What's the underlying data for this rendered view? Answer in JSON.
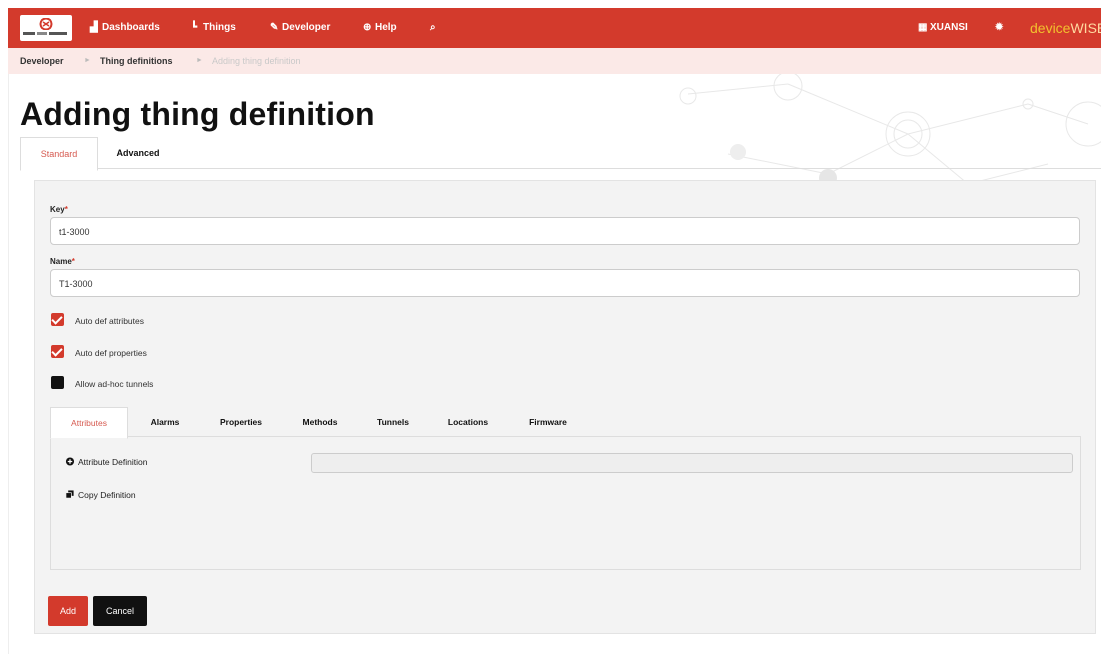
{
  "nav": {
    "items": [
      {
        "label": "Dashboards",
        "icon": "bar-chart-icon"
      },
      {
        "label": "Things",
        "icon": "sitemap-icon"
      },
      {
        "label": "Developer",
        "icon": "wrench-icon"
      },
      {
        "label": "Help",
        "icon": "help-circle-icon"
      }
    ],
    "search_icon": "search-icon",
    "user": "XUANSI",
    "settings_icon": "gear-icon",
    "brand_part1": "device",
    "brand_part2": "WISE"
  },
  "breadcrumb": {
    "items": [
      "Developer",
      "Thing definitions"
    ],
    "current": "Adding thing definition"
  },
  "page": {
    "title": "Adding thing definition"
  },
  "tabs": [
    {
      "label": "Standard",
      "active": true
    },
    {
      "label": "Advanced",
      "active": false
    }
  ],
  "form": {
    "key_label": "Key",
    "key_value": "t1-3000",
    "name_label": "Name",
    "name_value": "T1-3000",
    "required_mark": "*",
    "checkboxes": [
      {
        "label": "Auto def attributes",
        "checked": true
      },
      {
        "label": "Auto def properties",
        "checked": true
      },
      {
        "label": "Allow ad-hoc tunnels",
        "checked": false
      }
    ]
  },
  "subtabs": [
    {
      "label": "Attributes",
      "active": true
    },
    {
      "label": "Alarms",
      "active": false
    },
    {
      "label": "Properties",
      "active": false
    },
    {
      "label": "Methods",
      "active": false
    },
    {
      "label": "Tunnels",
      "active": false
    },
    {
      "label": "Locations",
      "active": false
    },
    {
      "label": "Firmware",
      "active": false
    }
  ],
  "attributes": {
    "add_definition": "Attribute Definition",
    "copy_definition": "Copy Definition"
  },
  "buttons": {
    "add": "Add",
    "cancel": "Cancel"
  },
  "colors": {
    "accent": "#d33a2c",
    "brand_yellow": "#f2c12e"
  }
}
